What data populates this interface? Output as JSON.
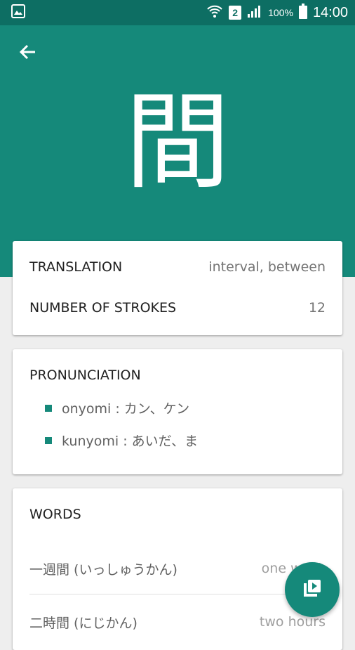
{
  "status_bar": {
    "battery_text": "100%",
    "time": "14:00",
    "sim_number": "2",
    "icons": [
      "image-icon",
      "wifi-icon",
      "sim-icon",
      "signal-icon",
      "battery-icon"
    ]
  },
  "header": {
    "kanji": "間",
    "back_icon": "arrow-back-icon",
    "color": "#15897a"
  },
  "info_card": {
    "translation_label": "TRANSLATION",
    "translation_value": "interval, between",
    "strokes_label": "NUMBER OF STROKES",
    "strokes_value": "12"
  },
  "pronunciation_card": {
    "title": "PRONUNCIATION",
    "items": [
      {
        "text": "onyomi :  カン、ケン"
      },
      {
        "text": "kunyomi :  あいだ、ま"
      }
    ]
  },
  "words_card": {
    "title": "WORDS",
    "words": [
      {
        "word": "一週間 (いっしゅうかん)",
        "meaning": "one week"
      },
      {
        "word": "二時間 (にじかん)",
        "meaning": "two hours"
      }
    ]
  },
  "fab": {
    "icon": "flashcards-icon"
  },
  "colors": {
    "primary": "#15897a",
    "primary_dark": "#0d6e63",
    "background": "#eeeeee"
  }
}
